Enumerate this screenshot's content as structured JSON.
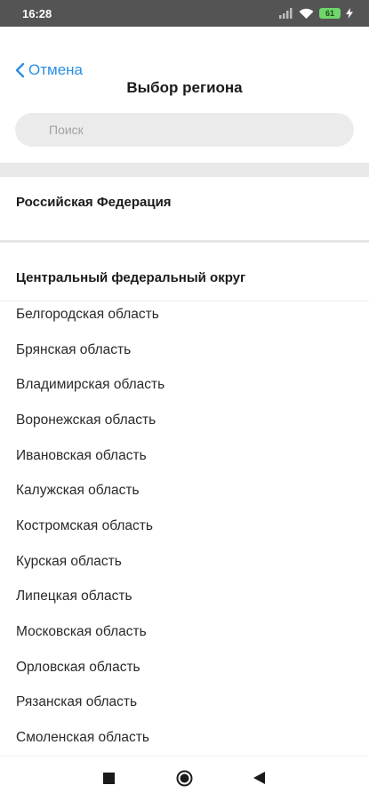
{
  "status_bar": {
    "time": "16:28",
    "battery_level": "61",
    "icons": [
      "signal-icon",
      "wifi-icon",
      "battery-icon",
      "charging-icon"
    ]
  },
  "header": {
    "cancel_label": "Отмена",
    "title": "Выбор региона"
  },
  "search": {
    "placeholder": "Поиск"
  },
  "country_row": {
    "label": "Российская Федерация"
  },
  "group": {
    "label": "Центральный федеральный округ",
    "items": [
      "Белгородская область",
      "Брянская область",
      "Владимирская область",
      "Воронежская область",
      "Ивановская область",
      "Калужская область",
      "Костромская область",
      "Курская область",
      "Липецкая область",
      "Московская область",
      "Орловская область",
      "Рязанская область",
      "Смоленская область"
    ]
  },
  "colors": {
    "accent": "#2b8fe6",
    "status_bar": "#545454",
    "search_bg": "#ebebeb",
    "separator": "#e9e9e9"
  },
  "nav_bar": {
    "icons": [
      "recents-square-icon",
      "home-circle-icon",
      "back-triangle-icon"
    ]
  }
}
